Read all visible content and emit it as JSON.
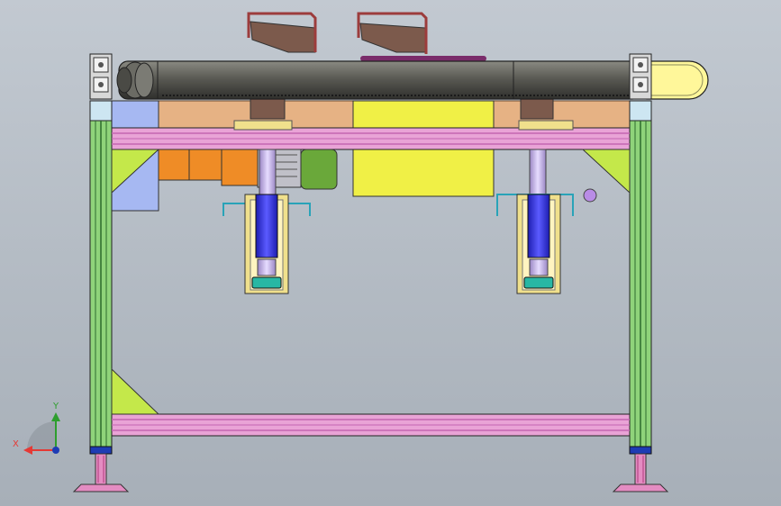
{
  "viewport": {
    "background_top": "#c2c9d1",
    "background_bottom": "#a7afb8"
  },
  "triad": {
    "x_label": "X",
    "y_label": "Y",
    "x_color": "#e53935",
    "y_color": "#2e9e2e",
    "z_color": "#1e3cb4"
  },
  "colors": {
    "profile_green": "#8fd37a",
    "profile_outline": "#2d2d2d",
    "beam_pink": "#e9a3d6",
    "beam_pink_dark": "#c466b1",
    "gusset": "#c4e84a",
    "roller": "#5a5a54",
    "tan_plate": "#e6b284",
    "yellow_block": "#f0f046",
    "light_blue": "#a6b8f2",
    "motor_orange": "#ef8c26",
    "motor_green": "#6aa83a",
    "cylinder_blue": "#3b3bd8",
    "cylinder_yellow": "#f0e08c",
    "rod_lavender": "#c7b3e8",
    "teal": "#28b7a4",
    "cyan_bracket": "#29a3b8",
    "brown_bracket": "#7c5a4c",
    "brown_outline": "#9c3c3c",
    "foot_pink": "#e48cc2",
    "foot_dark": "#b13a7c",
    "end_cap": "#fff79a",
    "ball": "#b98ce6",
    "purple_strip": "#7a2c6a"
  }
}
